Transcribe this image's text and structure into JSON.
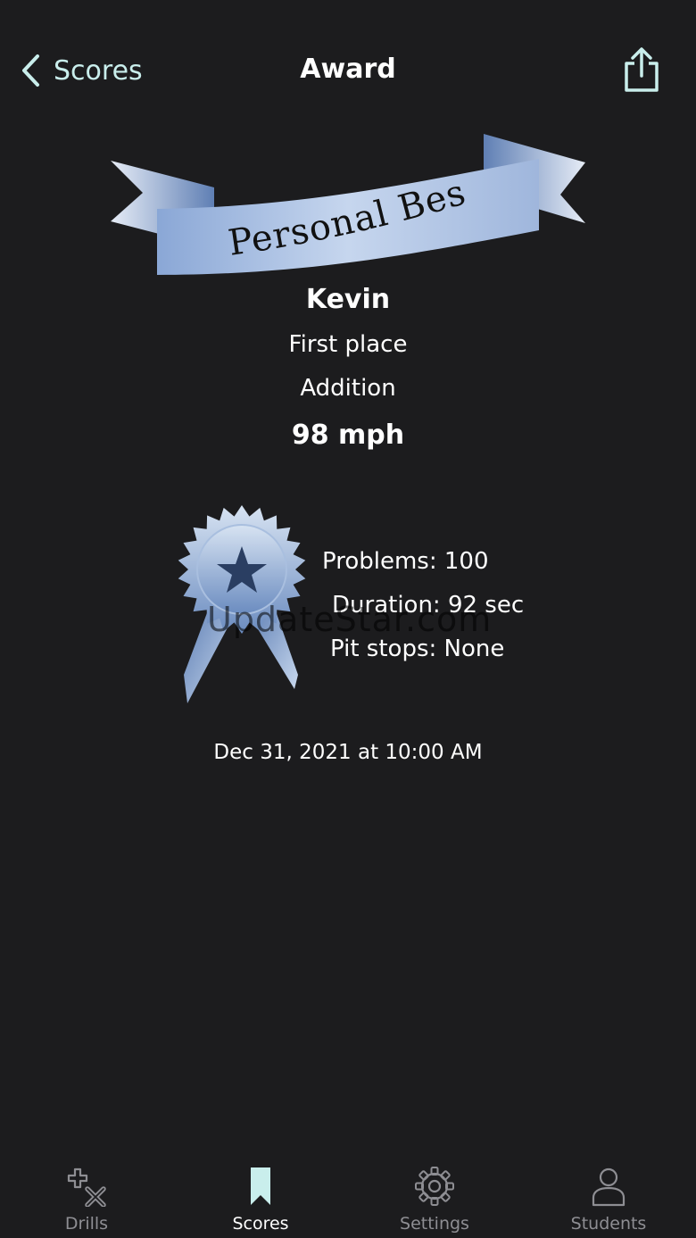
{
  "nav": {
    "back_label": "Scores",
    "title": "Award"
  },
  "banner": {
    "text": "Personal Best"
  },
  "award": {
    "student_name": "Kevin",
    "place": "First place",
    "drill_type": "Addition",
    "speed": "98 mph"
  },
  "stats": {
    "problems": "Problems: 100",
    "duration": "Duration: 92 sec",
    "pit_stops": "Pit stops: None"
  },
  "watermark": "UpdateStar.com",
  "date": "Dec 31, 2021 at 10:00 AM",
  "tabs": [
    {
      "label": "Drills",
      "icon": "plus-times-icon",
      "active": false
    },
    {
      "label": "Scores",
      "icon": "bookmark-icon",
      "active": true
    },
    {
      "label": "Settings",
      "icon": "gear-icon",
      "active": false
    },
    {
      "label": "Students",
      "icon": "person-icon",
      "active": false
    }
  ],
  "colors": {
    "background": "#1c1c1e",
    "accent": "#c9eeec",
    "inactive_tab": "#8e8e93",
    "ribbon_light": "#dce6f2",
    "ribbon_dark": "#6e8fc2"
  }
}
